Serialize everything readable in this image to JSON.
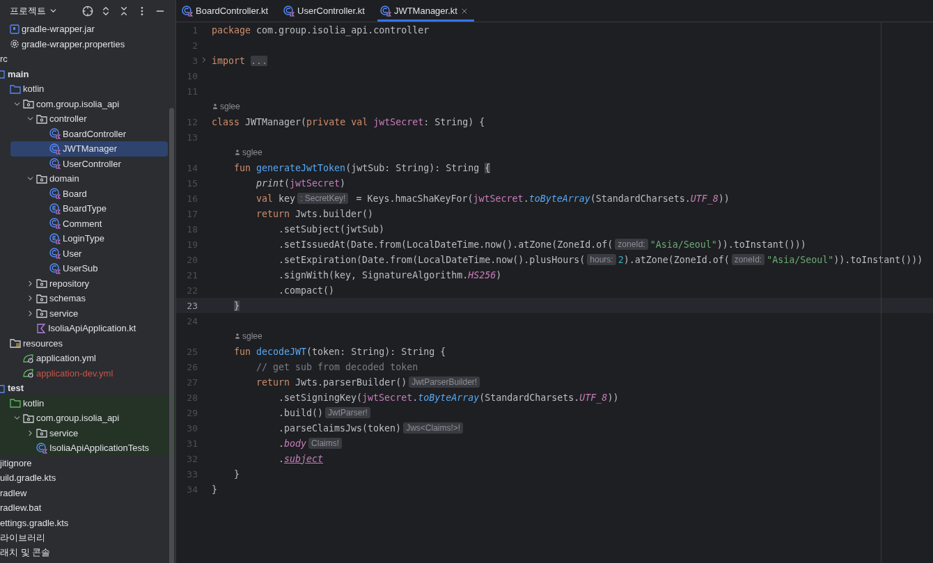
{
  "sidebar": {
    "title": "프로젝트",
    "tree": [
      {
        "label": "gradle-wrapper.jar",
        "kind": "jar",
        "selected": false
      },
      {
        "label": "gradle-wrapper.properties",
        "kind": "settings",
        "selected": false
      },
      {
        "label": "rc",
        "kind": "cut",
        "selected": false
      },
      {
        "label": "main",
        "kind": "source-root",
        "selected": false
      },
      {
        "label": "kotlin",
        "kind": "folder",
        "selected": false,
        "children": [
          {
            "label": "com.group.isolia_api",
            "kind": "package",
            "selected": false,
            "expanded": true,
            "children": [
              {
                "label": "controller",
                "kind": "package",
                "selected": false,
                "expanded": true,
                "children": [
                  {
                    "label": "BoardController",
                    "kind": "class",
                    "selected": false
                  },
                  {
                    "label": "JWTManager",
                    "kind": "class",
                    "selected": true
                  },
                  {
                    "label": "UserController",
                    "kind": "class",
                    "selected": false
                  }
                ]
              },
              {
                "label": "domain",
                "kind": "package",
                "selected": false,
                "expanded": true,
                "children": [
                  {
                    "label": "Board",
                    "kind": "class",
                    "selected": false
                  },
                  {
                    "label": "BoardType",
                    "kind": "enum",
                    "selected": false
                  },
                  {
                    "label": "Comment",
                    "kind": "class",
                    "selected": false
                  },
                  {
                    "label": "LoginType",
                    "kind": "enum",
                    "selected": false
                  },
                  {
                    "label": "User",
                    "kind": "class",
                    "selected": false
                  },
                  {
                    "label": "UserSub",
                    "kind": "class",
                    "selected": false
                  }
                ]
              },
              {
                "label": "repository",
                "kind": "package",
                "selected": false,
                "expanded": false
              },
              {
                "label": "schemas",
                "kind": "package",
                "selected": false,
                "expanded": false
              },
              {
                "label": "service",
                "kind": "package",
                "selected": false,
                "expanded": false
              },
              {
                "label": "IsoliaApiApplication.kt",
                "kind": "kotlin-file",
                "selected": false
              }
            ]
          }
        ]
      },
      {
        "label": "resources",
        "kind": "resources",
        "selected": false,
        "children": [
          {
            "label": "application.yml",
            "kind": "spring-config",
            "selected": false
          },
          {
            "label": "application-dev.yml",
            "kind": "spring-config",
            "selected": false,
            "color": "#c7544a"
          }
        ]
      },
      {
        "label": "test",
        "kind": "source-root",
        "selected": false
      },
      {
        "label": "kotlin",
        "kind": "test-folder",
        "selected": false,
        "children": [
          {
            "label": "com.group.isolia_api",
            "kind": "package",
            "selected": false,
            "expanded": true,
            "children": [
              {
                "label": "service",
                "kind": "package",
                "selected": false,
                "expanded": false
              },
              {
                "label": "IsoliaApiApplicationTests",
                "kind": "class",
                "selected": false
              }
            ]
          }
        ]
      },
      {
        "label": "jitignore",
        "kind": "cut",
        "selected": false
      },
      {
        "label": "uild.gradle.kts",
        "kind": "cut",
        "selected": false
      },
      {
        "label": "radlew",
        "kind": "cut",
        "selected": false
      },
      {
        "label": "radlew.bat",
        "kind": "cut",
        "selected": false
      },
      {
        "label": "ettings.gradle.kts",
        "kind": "cut",
        "selected": false
      },
      {
        "label": "라이브러리",
        "kind": "cut",
        "selected": false
      },
      {
        "label": "래치 및 콘솔",
        "kind": "cut",
        "selected": false
      }
    ]
  },
  "tabs": [
    {
      "label": "BoardController.kt",
      "selected": false
    },
    {
      "label": "UserController.kt",
      "selected": false
    },
    {
      "label": "JWTManager.kt",
      "selected": true
    }
  ],
  "editor": {
    "lines": [
      {
        "kind": "line",
        "number": "1",
        "current": false,
        "tokens": [
          {
            "kind": "kw",
            "text": "package"
          },
          {
            "kind": "plain",
            "text": " com.group.isolia_api.controller"
          }
        ]
      },
      {
        "kind": "line",
        "number": "2",
        "current": false
      },
      {
        "kind": "line",
        "number": "3",
        "current": false,
        "collapsed": true,
        "tokens": [
          {
            "kind": "kw",
            "text": "import"
          },
          {
            "kind": "folded",
            "text": "..."
          }
        ]
      },
      {
        "kind": "line",
        "number": "10",
        "current": false
      },
      {
        "kind": "line",
        "number": "11",
        "current": false
      },
      {
        "kind": "author",
        "text": "sglee"
      },
      {
        "kind": "line",
        "number": "12",
        "current": false,
        "tokens": [
          {
            "kind": "kw",
            "text": "class"
          },
          {
            "kind": "plain",
            "text": " JWTManager("
          },
          {
            "kind": "kw",
            "text": "private val"
          },
          {
            "kind": "prop",
            "text": " jwtSecret"
          },
          {
            "kind": "plain",
            "text": ": String) {"
          }
        ],
        "children": [
          {
            "kind": "line",
            "number": "13",
            "current": false
          },
          {
            "kind": "author",
            "text": "sglee"
          },
          {
            "kind": "line",
            "number": "14",
            "current": false,
            "tokens": [
              {
                "kind": "kw",
                "text": "fun"
              },
              {
                "kind": "fn",
                "text": " generateJwtToken"
              },
              {
                "kind": "plain",
                "text": "(jwtSub: String): String "
              },
              {
                "kind": "brace",
                "text": "{"
              }
            ],
            "children": [
              {
                "kind": "line",
                "number": "15",
                "current": false,
                "tokens": [
                  {
                    "kind": "italic",
                    "text": "print"
                  },
                  {
                    "kind": "plain",
                    "text": "("
                  },
                  {
                    "kind": "prop",
                    "text": "jwtSecret"
                  },
                  {
                    "kind": "plain",
                    "text": ")"
                  }
                ]
              },
              {
                "kind": "line",
                "number": "16",
                "current": false,
                "tokens": [
                  {
                    "kind": "kw",
                    "text": "val"
                  },
                  {
                    "kind": "plain",
                    "text": " key"
                  },
                  {
                    "kind": "hint",
                    "text": ": SecretKey!"
                  },
                  {
                    "kind": "plain",
                    "text": " = Keys.hmacShaKeyFor("
                  },
                  {
                    "kind": "prop",
                    "text": "jwtSecret"
                  },
                  {
                    "kind": "plain",
                    "text": "."
                  },
                  {
                    "kind": "ext",
                    "text": "toByteArray"
                  },
                  {
                    "kind": "plain",
                    "text": "(StandardCharsets."
                  },
                  {
                    "kind": "static",
                    "text": "UTF_8"
                  },
                  {
                    "kind": "plain",
                    "text": "))"
                  }
                ]
              },
              {
                "kind": "line",
                "number": "17",
                "current": false,
                "tokens": [
                  {
                    "kind": "kw",
                    "text": "return"
                  },
                  {
                    "kind": "plain",
                    "text": " Jwts.builder()"
                  }
                ],
                "children": [
                  {
                    "kind": "line",
                    "number": "18",
                    "current": false,
                    "tokens": [
                      {
                        "kind": "plain",
                        "text": ".setSubject(jwtSub)"
                      }
                    ]
                  },
                  {
                    "kind": "line",
                    "number": "19",
                    "current": false,
                    "tokens": [
                      {
                        "kind": "plain",
                        "text": ".setIssuedAt(Date.from(LocalDateTime.now().atZone(ZoneId.of("
                      },
                      {
                        "kind": "hint",
                        "text": "zoneId:"
                      },
                      {
                        "kind": "str",
                        "text": "\"Asia/Seoul\""
                      },
                      {
                        "kind": "plain",
                        "text": ")).toInstant()))"
                      }
                    ]
                  },
                  {
                    "kind": "line",
                    "number": "20",
                    "current": false,
                    "tokens": [
                      {
                        "kind": "plain",
                        "text": ".setExpiration(Date.from(LocalDateTime.now().plusHours("
                      },
                      {
                        "kind": "hint",
                        "text": "hours:"
                      },
                      {
                        "kind": "num",
                        "text": "2"
                      },
                      {
                        "kind": "plain",
                        "text": ").atZone(ZoneId.of("
                      },
                      {
                        "kind": "hint",
                        "text": "zoneId:"
                      },
                      {
                        "kind": "str",
                        "text": "\"Asia/Seoul\""
                      },
                      {
                        "kind": "plain",
                        "text": ")).toInstant()))"
                      }
                    ]
                  },
                  {
                    "kind": "line",
                    "number": "21",
                    "current": false,
                    "tokens": [
                      {
                        "kind": "plain",
                        "text": ".signWith(key, SignatureAlgorithm."
                      },
                      {
                        "kind": "static",
                        "text": "HS256"
                      },
                      {
                        "kind": "plain",
                        "text": ")"
                      }
                    ]
                  },
                  {
                    "kind": "line",
                    "number": "22",
                    "current": false,
                    "tokens": [
                      {
                        "kind": "plain",
                        "text": ".compact()"
                      }
                    ]
                  }
                ]
              }
            ]
          },
          {
            "kind": "line",
            "number": "23",
            "current": true,
            "tokens": [
              {
                "kind": "brace",
                "text": "}"
              }
            ]
          },
          {
            "kind": "line",
            "number": "24",
            "current": false
          },
          {
            "kind": "author",
            "text": "sglee"
          },
          {
            "kind": "line",
            "number": "25",
            "current": false,
            "tokens": [
              {
                "kind": "kw",
                "text": "fun"
              },
              {
                "kind": "fn",
                "text": " decodeJWT"
              },
              {
                "kind": "plain",
                "text": "(token: String): String {"
              }
            ],
            "children": [
              {
                "kind": "line",
                "number": "26",
                "current": false,
                "tokens": [
                  {
                    "kind": "comment",
                    "text": "// get sub from decoded token"
                  }
                ]
              },
              {
                "kind": "line",
                "number": "27",
                "current": false,
                "tokens": [
                  {
                    "kind": "kw",
                    "text": "return"
                  },
                  {
                    "kind": "plain",
                    "text": " Jwts.parserBuilder()"
                  },
                  {
                    "kind": "hint",
                    "text": "JwtParserBuilder!"
                  }
                ],
                "children": [
                  {
                    "kind": "line",
                    "number": "28",
                    "current": false,
                    "tokens": [
                      {
                        "kind": "plain",
                        "text": ".setSigningKey("
                      },
                      {
                        "kind": "prop",
                        "text": "jwtSecret"
                      },
                      {
                        "kind": "plain",
                        "text": "."
                      },
                      {
                        "kind": "ext",
                        "text": "toByteArray"
                      },
                      {
                        "kind": "plain",
                        "text": "(StandardCharsets."
                      },
                      {
                        "kind": "static",
                        "text": "UTF_8"
                      },
                      {
                        "kind": "plain",
                        "text": "))"
                      }
                    ]
                  },
                  {
                    "kind": "line",
                    "number": "29",
                    "current": false,
                    "tokens": [
                      {
                        "kind": "plain",
                        "text": ".build()"
                      },
                      {
                        "kind": "hint",
                        "text": "JwtParser!"
                      }
                    ]
                  },
                  {
                    "kind": "line",
                    "number": "30",
                    "current": false,
                    "tokens": [
                      {
                        "kind": "plain",
                        "text": ".parseClaimsJws(token)"
                      },
                      {
                        "kind": "hint",
                        "text": "Jws<Claims!>!"
                      }
                    ]
                  },
                  {
                    "kind": "line",
                    "number": "31",
                    "current": false,
                    "tokens": [
                      {
                        "kind": "plain",
                        "text": "."
                      },
                      {
                        "kind": "static",
                        "text": "body"
                      },
                      {
                        "kind": "hint",
                        "text": "Claims!"
                      }
                    ]
                  },
                  {
                    "kind": "line",
                    "number": "32",
                    "current": false,
                    "tokens": [
                      {
                        "kind": "plain",
                        "text": "."
                      },
                      {
                        "kind": "underline",
                        "text": "subject"
                      }
                    ]
                  }
                ]
              }
            ]
          },
          {
            "kind": "line",
            "number": "33",
            "current": false,
            "tokens": [
              {
                "kind": "plain",
                "text": "}"
              }
            ]
          }
        ]
      },
      {
        "kind": "line",
        "number": "34",
        "current": false,
        "tokens": [
          {
            "kind": "plain",
            "text": "}"
          }
        ]
      }
    ]
  }
}
